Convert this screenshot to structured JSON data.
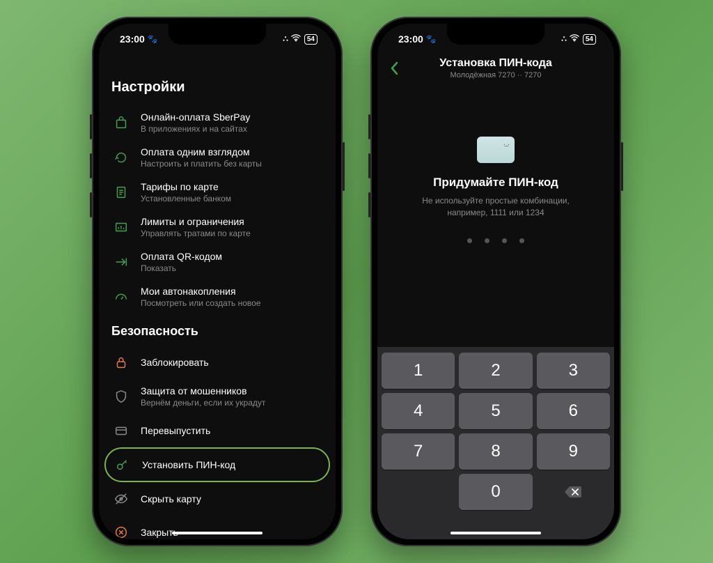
{
  "status": {
    "time": "23:00",
    "paw": "🐾",
    "battery": "54"
  },
  "phone1": {
    "page_title": "Настройки",
    "items": [
      {
        "title": "Онлайн-оплата SberPay",
        "sub": "В приложениях и на сайтах"
      },
      {
        "title": "Оплата одним взглядом",
        "sub": "Настроить и платить без карты"
      },
      {
        "title": "Тарифы по карте",
        "sub": "Установленные банком"
      },
      {
        "title": "Лимиты и ограничения",
        "sub": "Управлять тратами по карте"
      },
      {
        "title": "Оплата QR-кодом",
        "sub": "Показать"
      },
      {
        "title": "Мои автонакопления",
        "sub": "Посмотреть или создать новое"
      }
    ],
    "security_title": "Безопасность",
    "security_items": [
      {
        "title": "Заблокировать",
        "sub": ""
      },
      {
        "title": "Защита от мошенников",
        "sub": "Вернём деньги, если их украдут"
      },
      {
        "title": "Перевыпустить",
        "sub": ""
      },
      {
        "title": "Установить ПИН-код",
        "sub": ""
      },
      {
        "title": "Скрыть карту",
        "sub": ""
      },
      {
        "title": "Закрыть",
        "sub": ""
      }
    ]
  },
  "phone2": {
    "header_title": "Установка ПИН-кода",
    "header_sub": "Молодёжная 7270 ·· 7270",
    "pin_title": "Придумайте ПИН-код",
    "pin_hint1": "Не используйте простые комбинации,",
    "pin_hint2": "например, 1111 или 1234",
    "keys": [
      "1",
      "2",
      "3",
      "4",
      "5",
      "6",
      "7",
      "8",
      "9",
      "",
      "0",
      "⌫"
    ]
  }
}
